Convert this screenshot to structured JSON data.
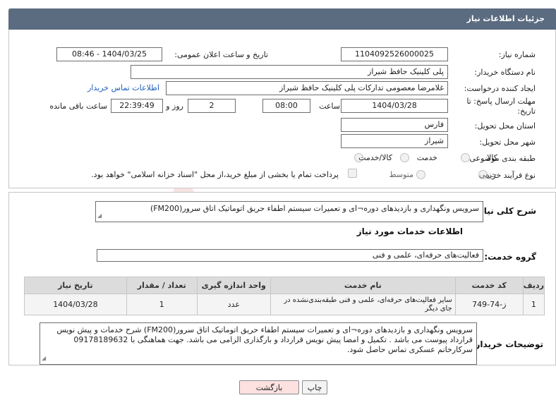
{
  "header": {
    "title": "جزئیات اطلاعات نیاز"
  },
  "form": {
    "need_number_label": "شماره نیاز:",
    "need_number": "1104092526000025",
    "announce_label": "تاریخ و ساعت اعلان عمومی:",
    "announce_value": "1404/03/25 - 08:46",
    "buyer_org_label": "نام دستگاه خریدار:",
    "buyer_org": "پلی کلینیک حافظ شیراز",
    "creator_label": "ایجاد کننده درخواست:",
    "creator": "غلامرضا معصومی تدارکات پلی کلینیک حافظ شیراز",
    "contact_link": "اطلاعات تماس خریدار",
    "deadline_label_1": "مهلت ارسال پاسخ: تا",
    "deadline_label_2": "تاریخ:",
    "deadline_date": "1404/03/28",
    "time_label": "ساعت",
    "deadline_time": "08:00",
    "days_value": "2",
    "days_label": "روز و",
    "remaining_time": "22:39:49",
    "remaining_label": "ساعت باقی مانده",
    "province_label": "استان محل تحویل:",
    "province": "فارس",
    "city_label": "شهر محل تحویل:",
    "city": "شیراز",
    "category_label": "طبقه بندی موضوعی:",
    "category_options": [
      "کالا",
      "خدمت",
      "کالا/خدمت"
    ],
    "process_label": "نوع فرآیند خرید :",
    "process_options": [
      "جزیی",
      "متوسط"
    ],
    "payment_note": "پرداخت تمام یا بخشی از مبلغ خرید،از محل \"اسناد خزانه اسلامی\" خواهد بود."
  },
  "general": {
    "label": "شرح کلی نیاز:",
    "text": "سرویس ونگهداری و بازدیدهای دوره¬ای و تعمیرات سیستم اطفاء حریق اتوماتیک اتاق سرور(FM200)"
  },
  "services": {
    "section_title": "اطلاعات خدمات مورد نیاز",
    "group_label": "گروه خدمت:",
    "group_value": "فعالیت‌های حرفه‌ای، علمی و فنی",
    "columns": [
      "ردیف",
      "کد خدمت",
      "نام خدمت",
      "واحد اندازه گیری",
      "تعداد / مقدار",
      "تاریخ نیاز"
    ],
    "rows": [
      {
        "index": "1",
        "code": "ز-74-749",
        "name": "سایر فعالیت‌های حرفه‌ای، علمی و فنی طبقه‌بندی‌نشده در جای دیگر",
        "unit": "عدد",
        "qty": "1",
        "date": "1404/03/28"
      }
    ]
  },
  "buyer_notes": {
    "label": "توضیحات خریدار:",
    "text": "سرویس ونگهداری و بازدیدهای دوره¬ای و تعمیرات سیستم اطفاء حریق اتوماتیک اتاق سرور(FM200)  شرح خدمات و پیش نویس قرارداد پیوست می باشد . تکمیل و امضا پیش نویس قرارداد و بارگذاری الزامی می باشد. جهت هماهنگی با 09178189632 سرکارخانم عسکری تماس حاصل شود."
  },
  "buttons": {
    "print": "چاپ",
    "back": "بازگشت"
  },
  "watermark": {
    "text": "AriaTender.neT"
  }
}
